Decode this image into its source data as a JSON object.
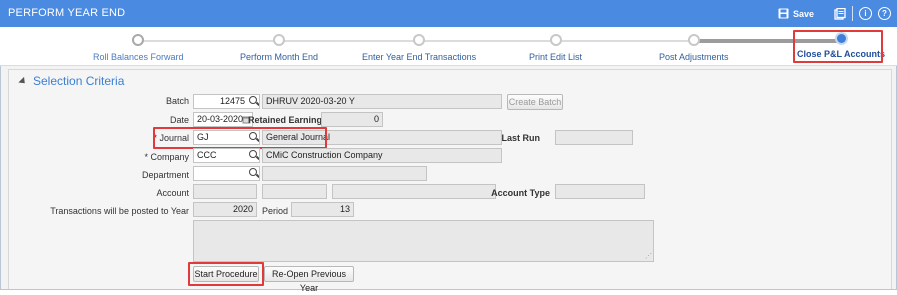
{
  "window": {
    "title": "PERFORM YEAR END"
  },
  "toolbar": {
    "save_label": "Save",
    "info_icon": "i",
    "help_icon": "?"
  },
  "wizard": {
    "steps": [
      {
        "label": "Roll Balances Forward"
      },
      {
        "label": "Perform Month End"
      },
      {
        "label": "Enter Year End Transactions"
      },
      {
        "label": "Print Edit List"
      },
      {
        "label": "Post Adjustments"
      },
      {
        "label": "Close P&L Accounts"
      }
    ],
    "active_step": "Close P&L Accounts"
  },
  "section": {
    "title": "Selection Criteria"
  },
  "form": {
    "batch": {
      "label": "Batch",
      "value": "12475",
      "desc": "DHRUV 2020-03-20 Y",
      "create_label": "Create Batch"
    },
    "date": {
      "label": "Date",
      "value": "20-03-2020"
    },
    "retained": {
      "label": "Retained Earnings",
      "value": "0"
    },
    "journal": {
      "label": "* Journal",
      "value": "GJ",
      "desc": "General Journal"
    },
    "last_run": {
      "label": "Last Run",
      "value": ""
    },
    "company": {
      "label": "* Company",
      "value": "CCC",
      "desc": "CMiC Construction Company"
    },
    "department": {
      "label": "Department",
      "value": "",
      "desc": ""
    },
    "account": {
      "label": "Account",
      "value": ""
    },
    "account_type": {
      "label": "Account Type",
      "value": ""
    },
    "post_year": {
      "label": "Transactions will be posted to Year",
      "value": "2020"
    },
    "period": {
      "label": "Period",
      "value": "13"
    }
  },
  "actions": {
    "start_label": "Start Procedure",
    "reopen_label": "Re-Open Previous Year"
  },
  "colors": {
    "titlebar": "#4a8ae0",
    "accent": "#3f7fd6",
    "highlight": "#e03a3a"
  }
}
